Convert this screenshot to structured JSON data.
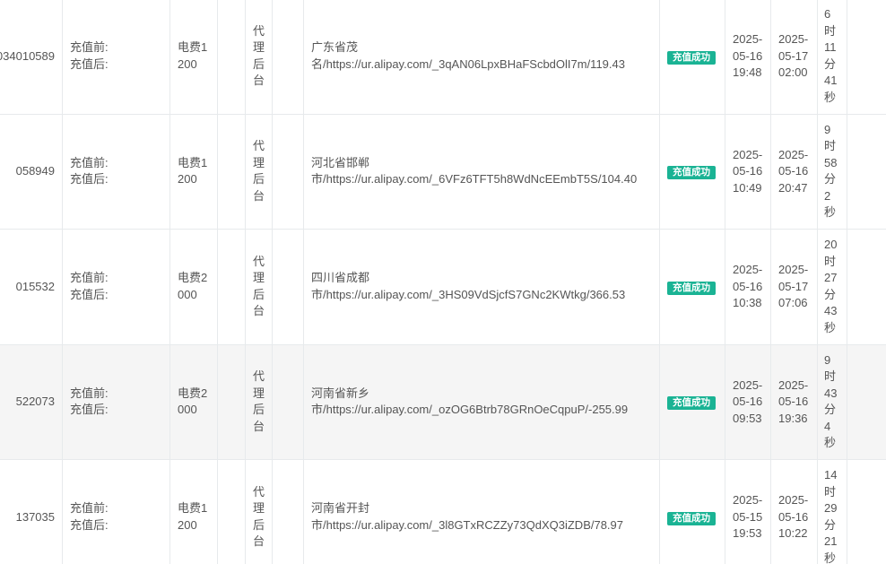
{
  "rows": [
    {
      "id": "034010589",
      "before_label": "充值前:",
      "after_label": "充值后:",
      "product": "电费1200",
      "channel": "代理后台",
      "province": "广东省茂",
      "detail": "名/https://ur.alipay.com/_3qAN06LpxBHaFScbdOlI7m/119.43",
      "status": "充值成功",
      "created": "2025-05-16 19:48",
      "finished": "2025-05-17 02:00",
      "duration": "6时11分41秒"
    },
    {
      "id": "058949",
      "before_label": "充值前:",
      "after_label": "充值后:",
      "product": "电费1200",
      "channel": "代理后台",
      "province": "河北省邯郸",
      "detail": "市/https://ur.alipay.com/_6VFz6TFT5h8WdNcEEmbT5S/104.40",
      "status": "充值成功",
      "created": "2025-05-16 10:49",
      "finished": "2025-05-16 20:47",
      "duration": "9时58分2秒"
    },
    {
      "id": "015532",
      "before_label": "充值前:",
      "after_label": "充值后:",
      "product": "电费2000",
      "channel": "代理后台",
      "province": "四川省成都",
      "detail": "市/https://ur.alipay.com/_3HS09VdSjcfS7GNc2KWtkg/366.53",
      "status": "充值成功",
      "created": "2025-05-16 10:38",
      "finished": "2025-05-17 07:06",
      "duration": "20时27分43秒"
    },
    {
      "id": "522073",
      "before_label": "充值前:",
      "after_label": "充值后:",
      "product": "电费2000",
      "channel": "代理后台",
      "province": "河南省新乡",
      "detail": "市/https://ur.alipay.com/_ozOG6Btrb78GRnOeCqpuP/-255.99",
      "status": "充值成功",
      "created": "2025-05-16 09:53",
      "finished": "2025-05-16 19:36",
      "duration": "9时43分4秒"
    },
    {
      "id": "137035",
      "before_label": "充值前:",
      "after_label": "充值后:",
      "product": "电费1200",
      "channel": "代理后台",
      "province": "河南省开封",
      "detail": "市/https://ur.alipay.com/_3l8GTxRCZZy73QdXQ3iZDB/78.97",
      "status": "充值成功",
      "created": "2025-05-15 19:53",
      "finished": "2025-05-16 10:22",
      "duration": "14时29分21秒"
    }
  ]
}
